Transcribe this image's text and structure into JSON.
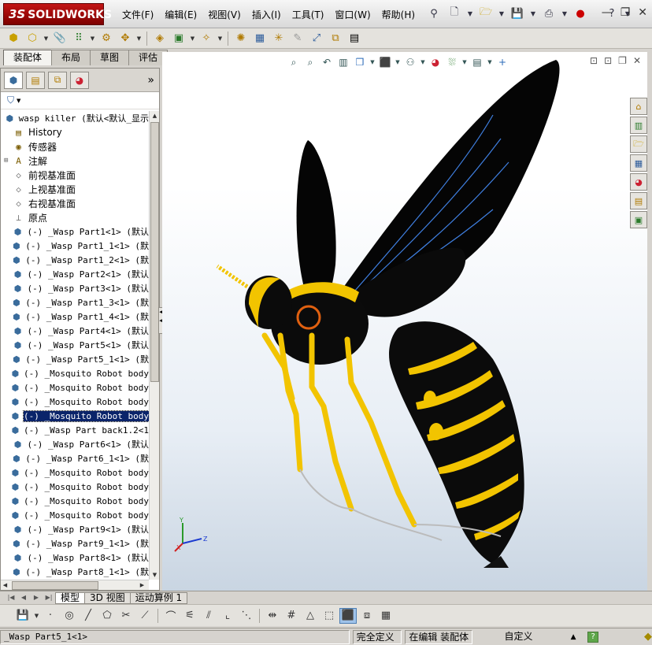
{
  "app": {
    "logo_prefix": "3S",
    "logo": "SOLIDWORKS"
  },
  "menu": [
    "文件(F)",
    "编辑(E)",
    "视图(V)",
    "插入(I)",
    "工具(T)",
    "窗口(W)",
    "帮助(H)"
  ],
  "command_tabs": [
    "装配体",
    "布局",
    "草图",
    "评估"
  ],
  "tree": {
    "root": "wasp killer  (默认<默认_显示",
    "items": [
      {
        "label": "History",
        "icon": "history-icon",
        "kind": "history"
      },
      {
        "label": "传感器",
        "icon": "sensor-icon",
        "kind": "cn"
      },
      {
        "label": "注解",
        "icon": "annotation-icon",
        "kind": "cn",
        "expandable": true
      },
      {
        "label": "前视基准面",
        "icon": "plane-icon",
        "kind": "cn"
      },
      {
        "label": "上视基准面",
        "icon": "plane-icon",
        "kind": "cn"
      },
      {
        "label": "右视基准面",
        "icon": "plane-icon",
        "kind": "cn"
      },
      {
        "label": "原点",
        "icon": "origin-icon",
        "kind": "cn"
      },
      {
        "label": "(-) _Wasp Part1<1> (默认",
        "icon": "part-icon"
      },
      {
        "label": "(-) _Wasp Part1_1<1> (默",
        "icon": "part-icon"
      },
      {
        "label": "(-) _Wasp Part1_2<1> (默",
        "icon": "part-icon"
      },
      {
        "label": "(-) _Wasp Part2<1> (默认",
        "icon": "part-icon"
      },
      {
        "label": "(-) _Wasp Part3<1> (默认",
        "icon": "part-icon"
      },
      {
        "label": "(-) _Wasp Part1_3<1> (默",
        "icon": "part-icon"
      },
      {
        "label": "(-) _Wasp Part1_4<1> (默",
        "icon": "part-icon"
      },
      {
        "label": "(-) _Wasp Part4<1> (默认",
        "icon": "part-icon"
      },
      {
        "label": "(-) _Wasp Part5<1> (默认",
        "icon": "part-icon"
      },
      {
        "label": "(-) _Wasp Part5_1<1> (默",
        "icon": "part-icon"
      },
      {
        "label": "(-) _Mosquito Robot body",
        "icon": "part-icon"
      },
      {
        "label": "(-) _Mosquito Robot body",
        "icon": "part-icon"
      },
      {
        "label": "(-) _Mosquito Robot body",
        "icon": "part-icon"
      },
      {
        "label": "(-) _Mosquito Robot body",
        "icon": "part-icon",
        "selected": true
      },
      {
        "label": "(-) _Wasp Part back1.2<1",
        "icon": "part-icon"
      },
      {
        "label": "(-) _Wasp Part6<1> (默认",
        "icon": "part-icon"
      },
      {
        "label": "(-) _Wasp Part6_1<1> (默",
        "icon": "part-icon"
      },
      {
        "label": "(-) _Mosquito Robot body",
        "icon": "part-icon"
      },
      {
        "label": "(-) _Mosquito Robot body",
        "icon": "part-icon"
      },
      {
        "label": "(-) _Mosquito Robot body",
        "icon": "part-icon"
      },
      {
        "label": "(-) _Mosquito Robot body",
        "icon": "part-icon"
      },
      {
        "label": "(-) _Wasp Part9<1> (默认",
        "icon": "part-icon"
      },
      {
        "label": "(-) _Wasp Part9_1<1> (默",
        "icon": "part-icon"
      },
      {
        "label": "(-) _Wasp Part8<1> (默认",
        "icon": "part-icon"
      },
      {
        "label": "(-) _Wasp Part8_1<1> (默",
        "icon": "part-icon"
      }
    ]
  },
  "model_tabs": [
    "模型",
    "3D 视图",
    "运动算例 1"
  ],
  "triad": {
    "y": "Y",
    "x": "X",
    "z": "Z"
  },
  "status": {
    "file": "_Wasp Part5_1<1>",
    "defined": "完全定义",
    "editing": "在编辑 装配体",
    "custom": "自定义",
    "help": "?"
  },
  "colors": {
    "wasp_body": "#0b0b0b",
    "wasp_stripe": "#f2c400",
    "wing": "#050505",
    "wing_vein": "#3f7fe0",
    "selection": "#0a246a"
  }
}
